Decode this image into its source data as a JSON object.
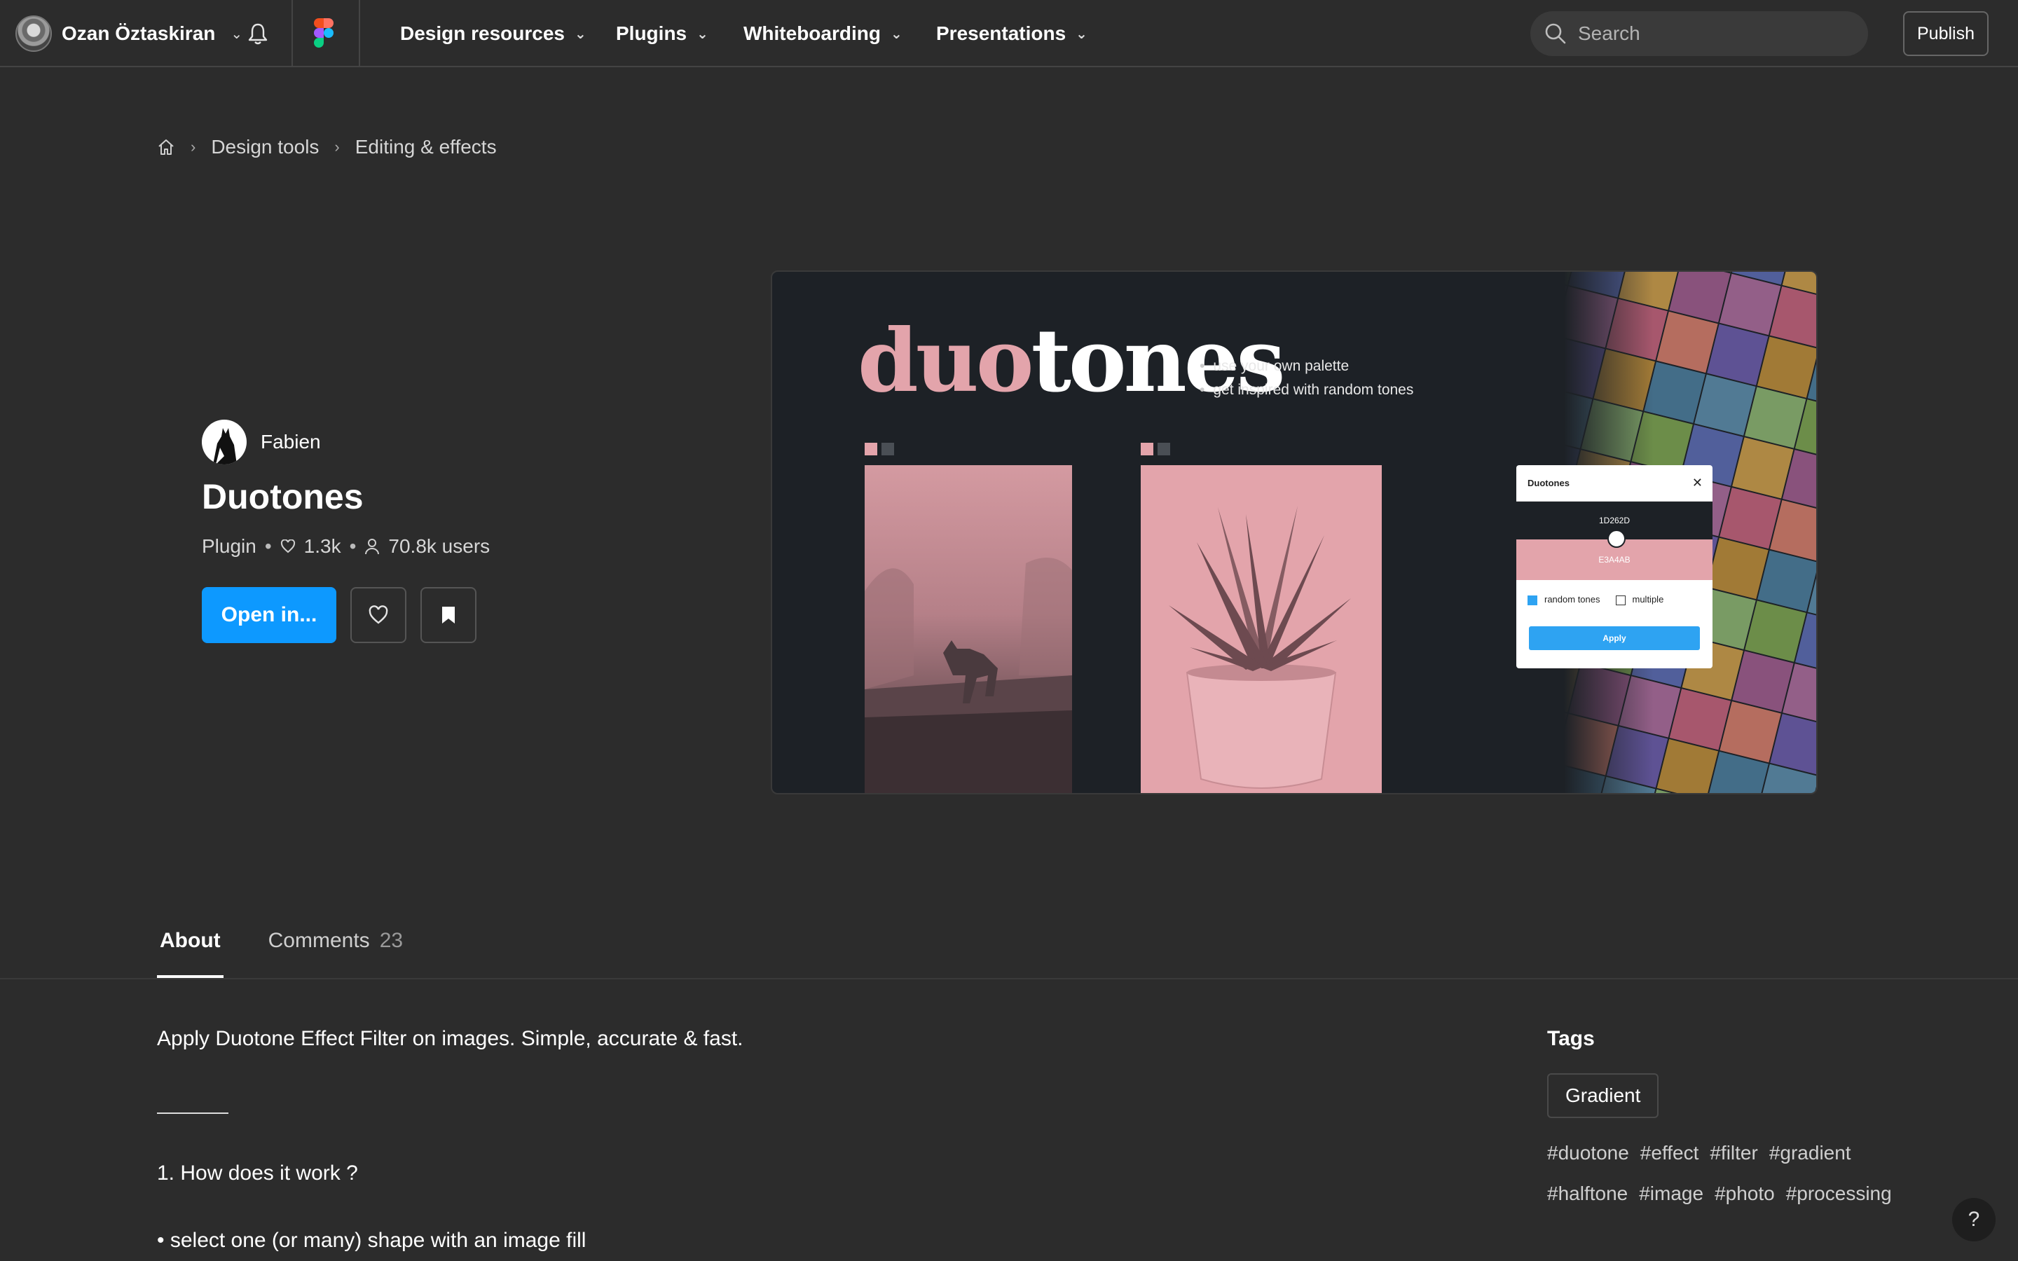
{
  "topbar": {
    "user_name": "Ozan Öztaskiran",
    "nav": [
      {
        "label": "Design resources"
      },
      {
        "label": "Plugins"
      },
      {
        "label": "Whiteboarding"
      },
      {
        "label": "Presentations"
      }
    ],
    "search_placeholder": "Search",
    "publish_label": "Publish"
  },
  "breadcrumb": {
    "items": [
      "Design tools",
      "Editing & effects"
    ],
    "separator": "›"
  },
  "plugin": {
    "author": "Fabien",
    "title": "Duotones",
    "type": "Plugin",
    "likes": "1.3k",
    "users": "70.8k users",
    "open_label": "Open in..."
  },
  "hero": {
    "title_pink": "duo",
    "title_white": "tones",
    "bullets": [
      "use your own palette",
      "get inspired with random tones"
    ],
    "popup": {
      "title": "Duotones",
      "dark_hex": "1D262D",
      "light_hex": "E3A4AB",
      "option_random": "random tones",
      "option_multiple": "multiple",
      "apply_label": "Apply"
    },
    "colors": {
      "pink": "#e3a4ab",
      "dark": "#1d2126"
    }
  },
  "tabs": [
    {
      "label": "About",
      "count": ""
    },
    {
      "label": "Comments",
      "count": "23"
    }
  ],
  "about": {
    "description": "Apply Duotone Effect Filter on images. Simple, accurate & fast.",
    "section_heading": "1. How does it work ?",
    "first_step": "• select one (or many) shape with an image fill"
  },
  "tags": {
    "title": "Tags",
    "category": "Gradient",
    "hashtags": [
      "#duotone",
      "#effect",
      "#filter",
      "#gradient",
      "#halftone",
      "#image",
      "#photo",
      "#processing"
    ]
  },
  "help_label": "?",
  "colors": {
    "accent": "#0d99ff",
    "background": "#2c2c2c"
  }
}
